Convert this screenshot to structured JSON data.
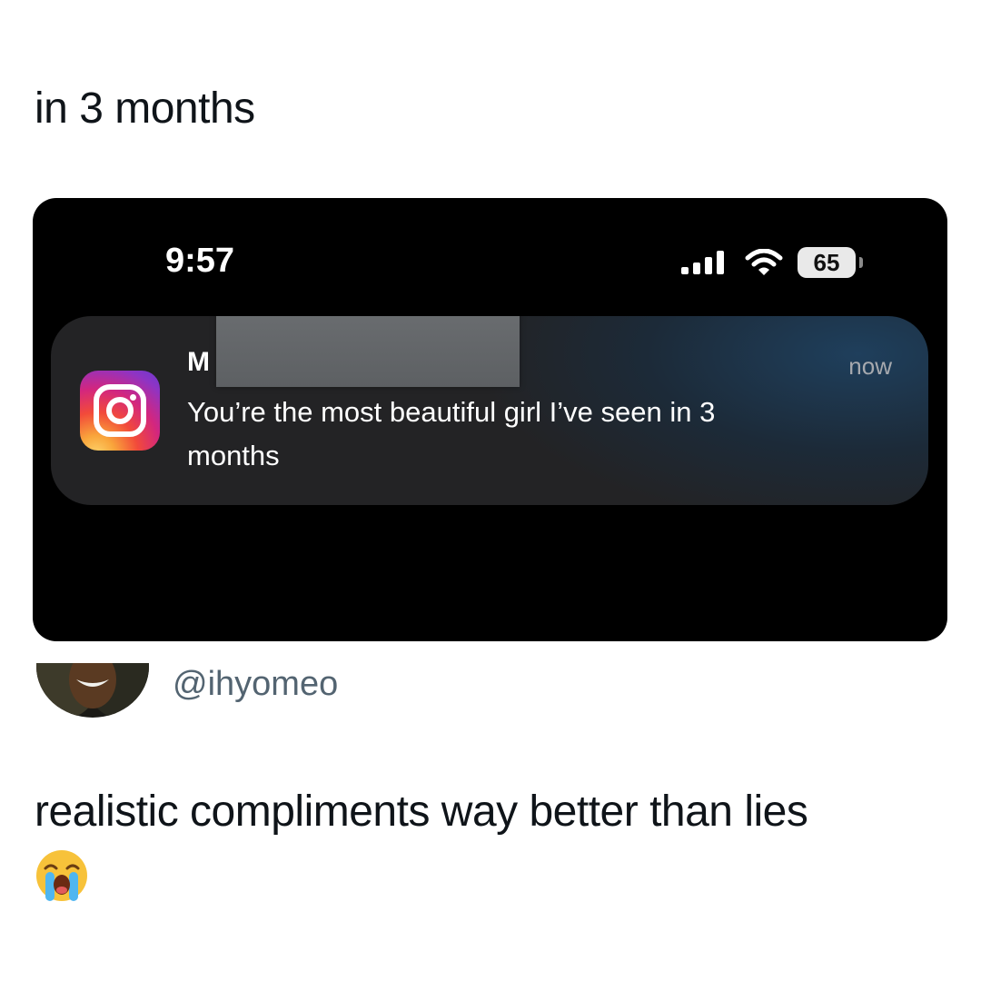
{
  "post": {
    "top_caption": "in 3 months",
    "handle": "@ihyomeo",
    "bottom_caption": "realistic compliments way better than lies",
    "emoji": "loudly-crying-face"
  },
  "phone": {
    "status_bar": {
      "time": "9:57",
      "battery": "65",
      "icons": [
        "cellular-signal-icon",
        "wifi-icon",
        "battery-icon"
      ]
    },
    "notification": {
      "app_icon": "instagram-icon",
      "sender": "M",
      "time": "now",
      "message": "You’re the most beautiful girl I’ve seen in 3 months"
    }
  }
}
